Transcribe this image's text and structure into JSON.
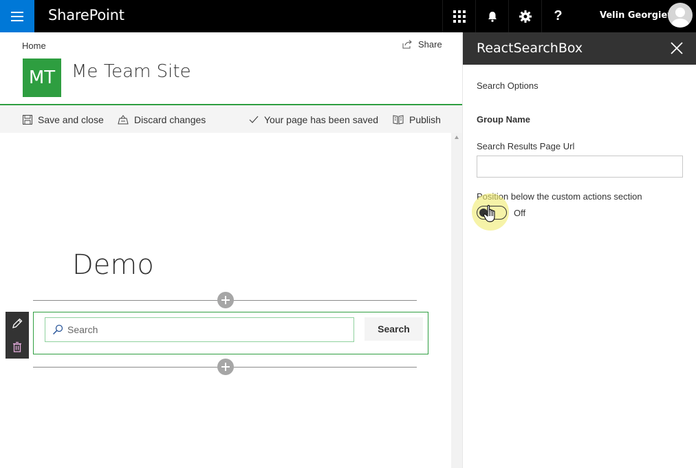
{
  "suitebar": {
    "brand": "SharePoint",
    "user_name": "Velin Georgiev",
    "help_glyph": "?",
    "icons": [
      "menu-icon",
      "app-launcher-icon",
      "bell-icon",
      "gear-icon",
      "help-icon",
      "user-avatar-icon"
    ],
    "accent": "#0078d7",
    "background": "#000000"
  },
  "header": {
    "breadcrumb": "Home",
    "share_label": "Share",
    "site_logo_initials": "MT",
    "site_logo_color": "#2e9e40",
    "site_title": "Me Team Site"
  },
  "command_bar": {
    "save_label": "Save and close",
    "discard_label": "Discard changes",
    "status_label": "Your page has been saved",
    "publish_label": "Publish"
  },
  "canvas": {
    "page_heading": "Demo",
    "search_webpart": {
      "placeholder": "Search",
      "value": "",
      "button_label": "Search"
    }
  },
  "property_pane": {
    "title": "ReactSearchBox",
    "description": "Search Options",
    "group_name": "Group Name",
    "url_field_label": "Search Results Page Url",
    "url_field_value": "",
    "toggle_label": "Position below the custom actions section",
    "toggle_state": "Off",
    "toggle_on": false
  }
}
